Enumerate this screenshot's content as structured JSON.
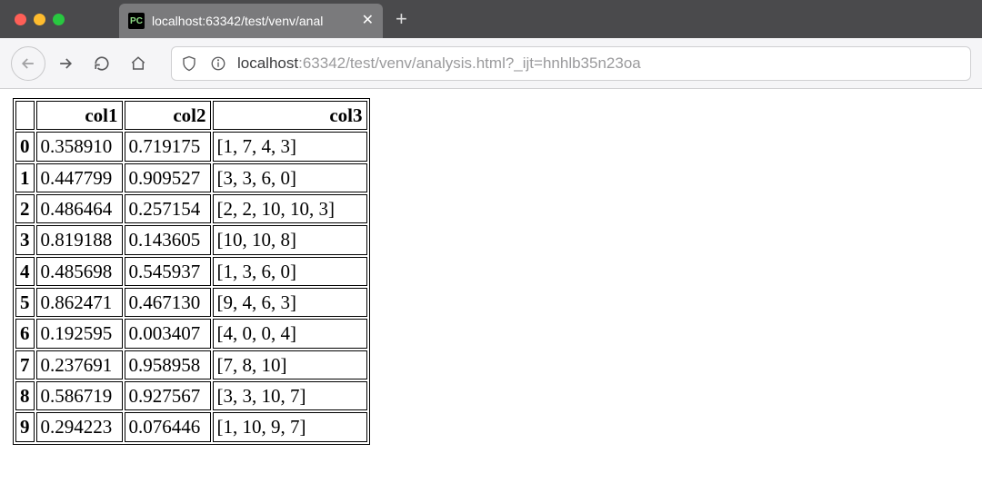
{
  "browser": {
    "tab_title": "localhost:63342/test/venv/anal",
    "favicon_text": "PC",
    "url_before": "localhost",
    "url_after": ":63342/test/venv/analysis.html?_ijt=hnhlb35n23oa"
  },
  "table": {
    "headers": [
      "col1",
      "col2",
      "col3"
    ],
    "rows": [
      {
        "idx": "0",
        "col1": "0.358910",
        "col2": "0.719175",
        "col3": "[1, 7, 4, 3]"
      },
      {
        "idx": "1",
        "col1": "0.447799",
        "col2": "0.909527",
        "col3": "[3, 3, 6, 0]"
      },
      {
        "idx": "2",
        "col1": "0.486464",
        "col2": "0.257154",
        "col3": "[2, 2, 10, 10, 3]"
      },
      {
        "idx": "3",
        "col1": "0.819188",
        "col2": "0.143605",
        "col3": "[10, 10, 8]"
      },
      {
        "idx": "4",
        "col1": "0.485698",
        "col2": "0.545937",
        "col3": "[1, 3, 6, 0]"
      },
      {
        "idx": "5",
        "col1": "0.862471",
        "col2": "0.467130",
        "col3": "[9, 4, 6, 3]"
      },
      {
        "idx": "6",
        "col1": "0.192595",
        "col2": "0.003407",
        "col3": "[4, 0, 0, 4]"
      },
      {
        "idx": "7",
        "col1": "0.237691",
        "col2": "0.958958",
        "col3": "[7, 8, 10]"
      },
      {
        "idx": "8",
        "col1": "0.586719",
        "col2": "0.927567",
        "col3": "[3, 3, 10, 7]"
      },
      {
        "idx": "9",
        "col1": "0.294223",
        "col2": "0.076446",
        "col3": "[1, 10, 9, 7]"
      }
    ]
  }
}
